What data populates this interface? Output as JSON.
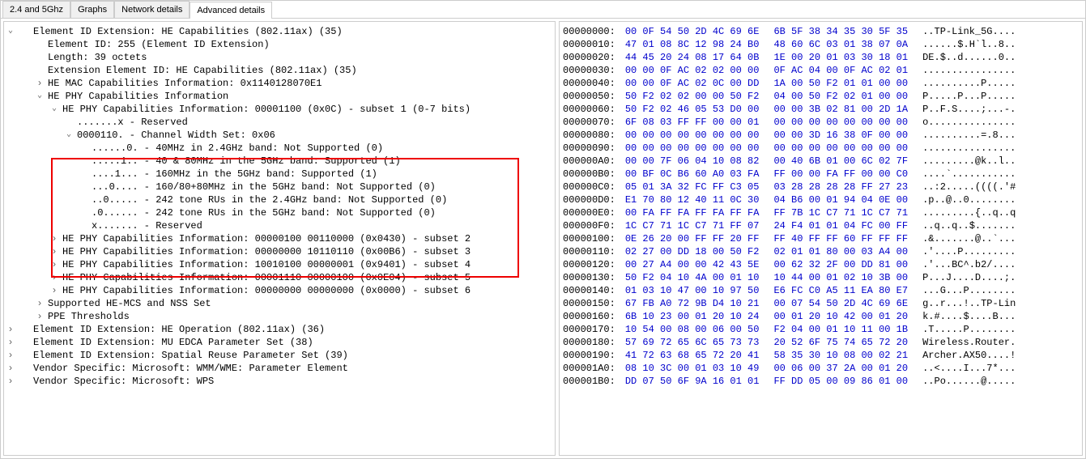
{
  "tabs": [
    "2.4 and 5Ghz",
    "Graphs",
    "Network details",
    "Advanced details"
  ],
  "activeTab": 3,
  "tree": {
    "root0": "Element ID Extension: HE Capabilities (802.11ax) (35)",
    "eid": "Element ID: 255 (Element ID Extension)",
    "len": "Length: 39 octets",
    "ext": "Extension Element ID: HE Capabilities (802.11ax) (35)",
    "mac": "HE MAC Capabilities Information: 0x1140128070E1",
    "phy": "HE PHY Capabilities Information",
    "phy_s1": "HE PHY Capabilities Information: 00001100 (0x0C) - subset 1 (0-7 bits)",
    "phy_s1_r": ".......x - Reserved",
    "cws": "0000110. - Channel Width Set: 0x06",
    "cws_a": "......0. - 40MHz in 2.4GHz band: Not Supported (0)",
    "cws_b": ".....1.. - 40 & 80MHz in the 5GHz band: Supported (1)",
    "cws_c": "....1... - 160MHz in the 5GHz band: Supported (1)",
    "cws_d": "...0.... - 160/80+80MHz in the 5GHz band: Not Supported (0)",
    "cws_e": "..0..... - 242 tone RUs in the 2.4GHz band: Not Supported (0)",
    "cws_f": ".0...... - 242 tone RUs in the 5GHz band: Not Supported (0)",
    "cws_g": "x....... - Reserved",
    "phy_s2": "HE PHY Capabilities Information: 00000100 00110000 (0x0430) - subset 2",
    "phy_s3": "HE PHY Capabilities Information: 00000000 10110110 (0x00B6) - subset 3",
    "phy_s4": "HE PHY Capabilities Information: 10010100 00000001 (0x9401) - subset 4",
    "phy_s5": "HE PHY Capabilities Information: 00001110 00000100 (0x0E04) - subset 5",
    "phy_s6": "HE PHY Capabilities Information: 00000000 00000000 (0x0000) - subset 6",
    "mcs": "Supported HE-MCS and NSS Set",
    "ppe": "PPE Thresholds",
    "heop": "Element ID Extension: HE Operation (802.11ax) (36)",
    "muedca": "Element ID Extension: MU EDCA Parameter Set (38)",
    "spatial": "Element ID Extension: Spatial Reuse Parameter Set (39)",
    "wmm": "Vendor Specific: Microsoft: WMM/WME: Parameter Element",
    "wps": "Vendor Specific: Microsoft: WPS"
  },
  "hex": [
    {
      "o": "00000000:",
      "b1": "00 0F 54 50 2D 4C 69 6E",
      "b2": "6B 5F 38 34 35 30 5F 35",
      "a": "..TP-Link_5G...."
    },
    {
      "o": "00000010:",
      "b1": "47 01 08 8C 12 98 24 B0",
      "b2": "48 60 6C 03 01 38 07 0A",
      "a": "......$.H`l..8.."
    },
    {
      "o": "00000020:",
      "b1": "44 45 20 24 08 17 64 0B",
      "b2": "1E 00 20 01 03 30 18 01",
      "a": "DE.$..d......0.."
    },
    {
      "o": "00000030:",
      "b1": "00 00 0F AC 02 02 00 00",
      "b2": "0F AC 04 00 0F AC 02 01",
      "a": "................"
    },
    {
      "o": "00000040:",
      "b1": "00 00 0F AC 02 0C 00 DD",
      "b2": "1A 00 50 F2 01 01 00 00",
      "a": "..........P....."
    },
    {
      "o": "00000050:",
      "b1": "50 F2 02 02 00 00 50 F2",
      "b2": "04 00 50 F2 02 01 00 00",
      "a": "P.....P...P....."
    },
    {
      "o": "00000060:",
      "b1": "50 F2 02 46 05 53 D0 00",
      "b2": "00 00 3B 02 81 00 2D 1A",
      "a": "P..F.S....;...-."
    },
    {
      "o": "00000070:",
      "b1": "6F 08 03 FF FF 00 00 01",
      "b2": "00 00 00 00 00 00 00 00",
      "a": "o..............."
    },
    {
      "o": "00000080:",
      "b1": "00 00 00 00 00 00 00 00",
      "b2": "00 00 3D 16 38 0F 00 00",
      "a": "..........=.8..."
    },
    {
      "o": "00000090:",
      "b1": "00 00 00 00 00 00 00 00",
      "b2": "00 00 00 00 00 00 00 00",
      "a": "................"
    },
    {
      "o": "000000A0:",
      "b1": "00 00 7F 06 04 10 08 82",
      "b2": "00 40 6B 01 00 6C 02 7F",
      "a": ".........@k..l.."
    },
    {
      "o": "000000B0:",
      "b1": "00 BF 0C B6 60 A0 03 FA",
      "b2": "FF 00 00 FA FF 00 00 C0",
      "a": "....`..........."
    },
    {
      "o": "000000C0:",
      "b1": "05 01 3A 32 FC FF C3 05",
      "b2": "03 28 28 28 28 FF 27 23",
      "a": "..:2.....((((.'#"
    },
    {
      "o": "000000D0:",
      "b1": "E1 70 80 12 40 11 0C 30",
      "b2": "04 B6 00 01 94 04 0E 00",
      "a": ".p..@..0........"
    },
    {
      "o": "000000E0:",
      "b1": "00 FA FF FA FF FA FF FA",
      "b2": "FF 7B 1C C7 71 1C C7 71",
      "a": ".........{..q..q"
    },
    {
      "o": "000000F0:",
      "b1": "1C C7 71 1C C7 71 FF 07",
      "b2": "24 F4 01 01 04 FC 00 FF",
      "a": "..q..q..$......."
    },
    {
      "o": "00000100:",
      "b1": "0E 26 20 00 FF FF 20 FF",
      "b2": "FF 40 FF FF 60 FF FF FF",
      "a": ".&.......@..`..."
    },
    {
      "o": "00000110:",
      "b1": "02 27 00 DD 18 00 50 F2",
      "b2": "02 01 01 80 00 03 A4 00",
      "a": ".'....P........."
    },
    {
      "o": "00000120:",
      "b1": "00 27 A4 00 00 42 43 5E",
      "b2": "00 62 32 2F 00 DD 81 00",
      "a": ".'...BC^.b2/...."
    },
    {
      "o": "00000130:",
      "b1": "50 F2 04 10 4A 00 01 10",
      "b2": "10 44 00 01 02 10 3B 00",
      "a": "P...J....D....;."
    },
    {
      "o": "00000140:",
      "b1": "01 03 10 47 00 10 97 50",
      "b2": "E6 FC C0 A5 11 EA 80 E7",
      "a": "...G...P........"
    },
    {
      "o": "00000150:",
      "b1": "67 FB A0 72 9B D4 10 21",
      "b2": "00 07 54 50 2D 4C 69 6E",
      "a": "g..r...!..TP-Lin"
    },
    {
      "o": "00000160:",
      "b1": "6B 10 23 00 01 20 10 24",
      "b2": "00 01 20 10 42 00 01 20",
      "a": "k.#....$....B..."
    },
    {
      "o": "00000170:",
      "b1": "10 54 00 08 00 06 00 50",
      "b2": "F2 04 00 01 10 11 00 1B",
      "a": ".T.....P........"
    },
    {
      "o": "00000180:",
      "b1": "57 69 72 65 6C 65 73 73",
      "b2": "20 52 6F 75 74 65 72 20",
      "a": "Wireless.Router."
    },
    {
      "o": "00000190:",
      "b1": "41 72 63 68 65 72 20 41",
      "b2": "58 35 30 10 08 00 02 21",
      "a": "Archer.AX50....!"
    },
    {
      "o": "000001A0:",
      "b1": "08 10 3C 00 01 03 10 49",
      "b2": "00 06 00 37 2A 00 01 20",
      "a": "..<....I...7*..."
    },
    {
      "o": "000001B0:",
      "b1": "DD 07 50 6F 9A 16 01 01",
      "b2": "FF DD 05 00 09 86 01 00",
      "a": "..Po......@....."
    }
  ]
}
